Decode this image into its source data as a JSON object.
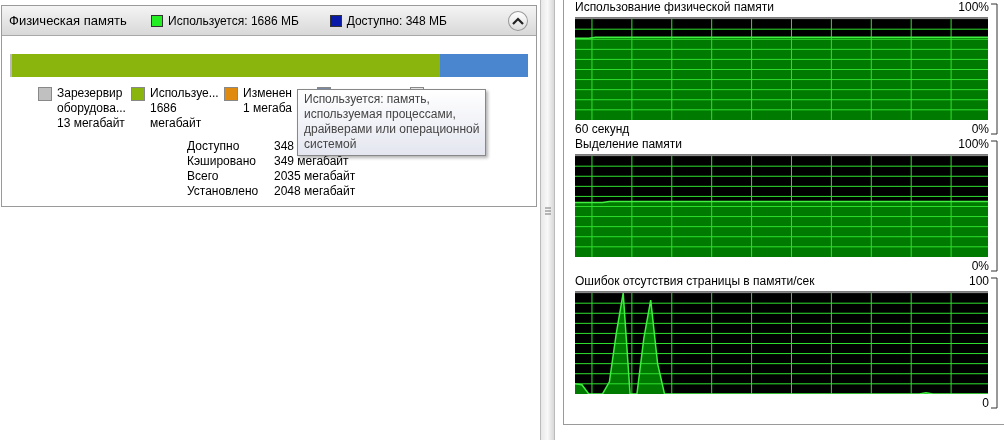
{
  "memory_panel": {
    "title": "Физическая память",
    "summary": [
      {
        "label": "Используется: 1686 МБ",
        "color": "#22ee22"
      },
      {
        "label": "Доступно: 348 МБ",
        "color": "#0a1aa8"
      }
    ],
    "expanded": true,
    "bar": {
      "level": 0.83
    },
    "legend": [
      {
        "lines": [
          "Зарезервир",
          "оборудова...",
          "13 мегабайт"
        ],
        "color": "#c0c0c0"
      },
      {
        "lines": [
          "Используе...",
          "1686",
          "мегабайт"
        ],
        "color": "#8ab50c"
      },
      {
        "lines": [
          "Изменен",
          "1 мегаба"
        ],
        "color": "#e08a10"
      },
      {
        "color": "#7a8ca8"
      },
      {
        "color": "#e8e8e8"
      }
    ],
    "stats": [
      {
        "label": "Доступно",
        "value": "348"
      },
      {
        "label": "Кэшировано",
        "value": "349 мегабайт"
      },
      {
        "label": "Всего",
        "value": "2035 мегабайт"
      },
      {
        "label": "Установлено",
        "value": "2048 мегабайт"
      }
    ],
    "tooltip": [
      "Используется: память,",
      "используемая процессами,",
      "драйверами или операционной",
      "системой"
    ]
  },
  "graphs": [
    {
      "title": "Использование физической памяти",
      "max_label": "100%",
      "min_label": "0%",
      "time_label": "60 секунд"
    },
    {
      "title": "Выделение памяти",
      "max_label": "100%",
      "min_label": "0%"
    },
    {
      "title": "Ошибок отсутствия страницы в памяти/сек",
      "max_label": "100",
      "min_label": "0"
    }
  ]
}
